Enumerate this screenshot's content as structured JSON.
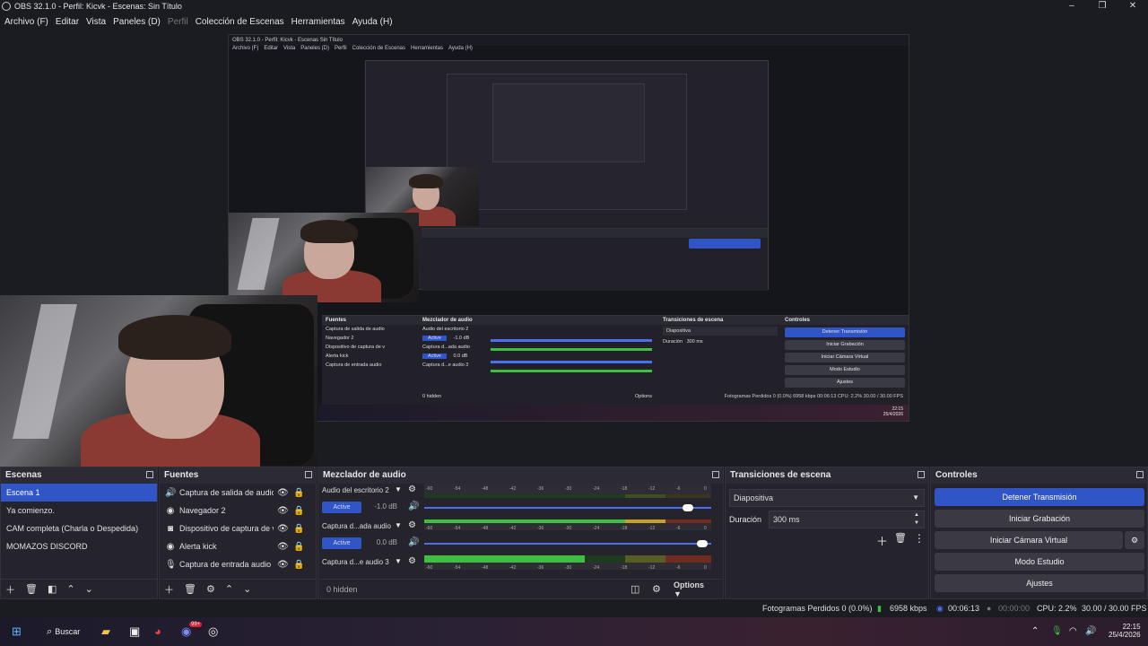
{
  "window": {
    "title": "OBS 32.1.0 - Perfil: Kicvk - Escenas: Sin Título",
    "controls": [
      "–",
      "❐",
      "✕"
    ]
  },
  "menu": [
    {
      "label": "Archivo (F)",
      "disabled": false
    },
    {
      "label": "Editar",
      "disabled": false
    },
    {
      "label": "Vista",
      "disabled": false
    },
    {
      "label": "Paneles (D)",
      "disabled": false
    },
    {
      "label": "Perfil",
      "disabled": true
    },
    {
      "label": "Colección de Escenas",
      "disabled": false
    },
    {
      "label": "Herramientas",
      "disabled": false
    },
    {
      "label": "Ayuda (H)",
      "disabled": false
    }
  ],
  "nested": {
    "title": "OBS 32.1.0 - Perfil: Kicvk - Escenas Sin Título",
    "menu": [
      "Archivo (F)",
      "Editar",
      "Vista",
      "Paneles (D)",
      "Perfil",
      "Colección de Escenas",
      "Herramientas",
      "Ayuda (H)"
    ],
    "sources": [
      "Captura de salida de audio",
      "Navegador 2",
      "Dispositivo de captura de v",
      "Alerta kick",
      "Captura de entrada audio"
    ],
    "mixer": [
      "Audio del escritorio 2",
      "Captura d...ada audio",
      "Captura d...e audio 3"
    ],
    "mixer_title": "Mezclador de audio",
    "sources_title": "Fuentes",
    "transitions_title": "Transiciones de escena",
    "controls_title": "Controles",
    "controls": [
      "Detener Transmisión",
      "Iniciar Grabación",
      "Iniciar Cámara Virtual",
      "Modo Estudio",
      "Ajustes"
    ],
    "status": "Fotogramas Perdidos 0 (0.0%)   6958 kbps   00:06:13   CPU: 2.2%   30.00 / 30.00 FPS",
    "hidden": "0 hidden",
    "options": "Options",
    "trans": "Diapositiva",
    "duration": "Duración",
    "duration_val": "300 ms",
    "clock_time": "22:15",
    "clock_date": "25/4/2026",
    "db1": "-1.0 dB",
    "db2": "0.0 dB",
    "active": "Active"
  },
  "docks": {
    "scenes": {
      "title": "Escenas",
      "items": [
        "Escena 1",
        "Ya comienzo.",
        "CAM completa (Charla o Despedida)",
        "MOMAZOS DISCORD"
      ],
      "active_index": 0
    },
    "sources": {
      "title": "Fuentes",
      "items": [
        {
          "icon": "speaker-icon",
          "glyph": "🔊",
          "label": "Captura de salida de audic"
        },
        {
          "icon": "browser-icon",
          "glyph": "◉",
          "label": "Navegador 2"
        },
        {
          "icon": "camera-icon",
          "glyph": "◙",
          "label": "Dispositivo de captura de v"
        },
        {
          "icon": "browser-icon",
          "glyph": "◉",
          "label": "Alerta kick"
        },
        {
          "icon": "microphone-icon",
          "glyph": "🎙",
          "label": "Captura de entrada audio"
        }
      ]
    },
    "mixer": {
      "title": "Mezclador de audio",
      "hidden": "0 hidden",
      "options": "Options",
      "scale": [
        "-60",
        "-54",
        "-48",
        "-42",
        "-36",
        "-30",
        "-24",
        "-18",
        "-12",
        "-6",
        "0"
      ],
      "channels": [
        {
          "name": "Audio del escritorio 2",
          "active_label": "Active",
          "db": "-1.0 dB",
          "level": 0.0,
          "volume": 0.92
        },
        {
          "name": "Captura d...ada audio",
          "active_label": "Active",
          "db": "0.0 dB",
          "level": 0.77,
          "volume": 0.97
        },
        {
          "name": "Captura d...e audio 3",
          "level": 0.56
        }
      ]
    },
    "transitions": {
      "title": "Transiciones de escena",
      "type": "Diapositiva",
      "duration_label": "Duración",
      "duration": "300 ms"
    },
    "controls": {
      "title": "Controles",
      "stream": "Detener Transmisión",
      "record": "Iniciar Grabación",
      "virtualcam": "Iniciar Cámara Virtual",
      "studio": "Modo Estudio",
      "settings": "Ajustes"
    }
  },
  "status": {
    "dropped": "Fotogramas Perdidos 0 (0.0%)",
    "bitrate": "6958 kbps",
    "stream_time": "00:06:13",
    "record_time": "00:00:00",
    "cpu": "CPU: 2.2%",
    "fps": "30.00 / 30.00 FPS"
  },
  "taskbar": {
    "search": "Buscar",
    "time": "22:15",
    "date": "25/4/2026",
    "discord_badge": "99+"
  }
}
